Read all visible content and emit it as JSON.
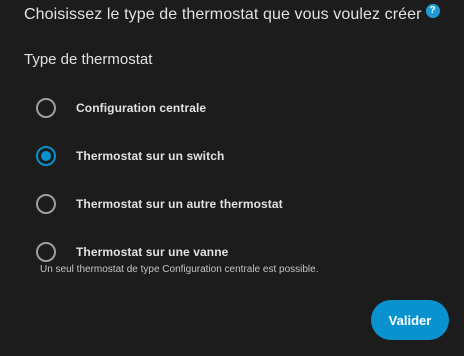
{
  "dialog": {
    "title": "Choisissez le type de thermostat que vous voulez créer",
    "help_icon": "question-circle-icon",
    "help_glyph": "?"
  },
  "form": {
    "section_label": "Type de thermostat",
    "options": [
      {
        "label": "Configuration centrale",
        "selected": false
      },
      {
        "label": "Thermostat sur un switch",
        "selected": true
      },
      {
        "label": "Thermostat sur un autre thermostat",
        "selected": false
      },
      {
        "label": "Thermostat sur une vanne",
        "selected": false
      }
    ],
    "hint": "Un seul thermostat de type Configuration centrale est possible."
  },
  "actions": {
    "submit_label": "Valider"
  },
  "colors": {
    "background": "#1c1c1c",
    "accent": "#0893cf",
    "radio_unselected": "#9e9e9e",
    "help_icon": "#1e9bd8"
  }
}
